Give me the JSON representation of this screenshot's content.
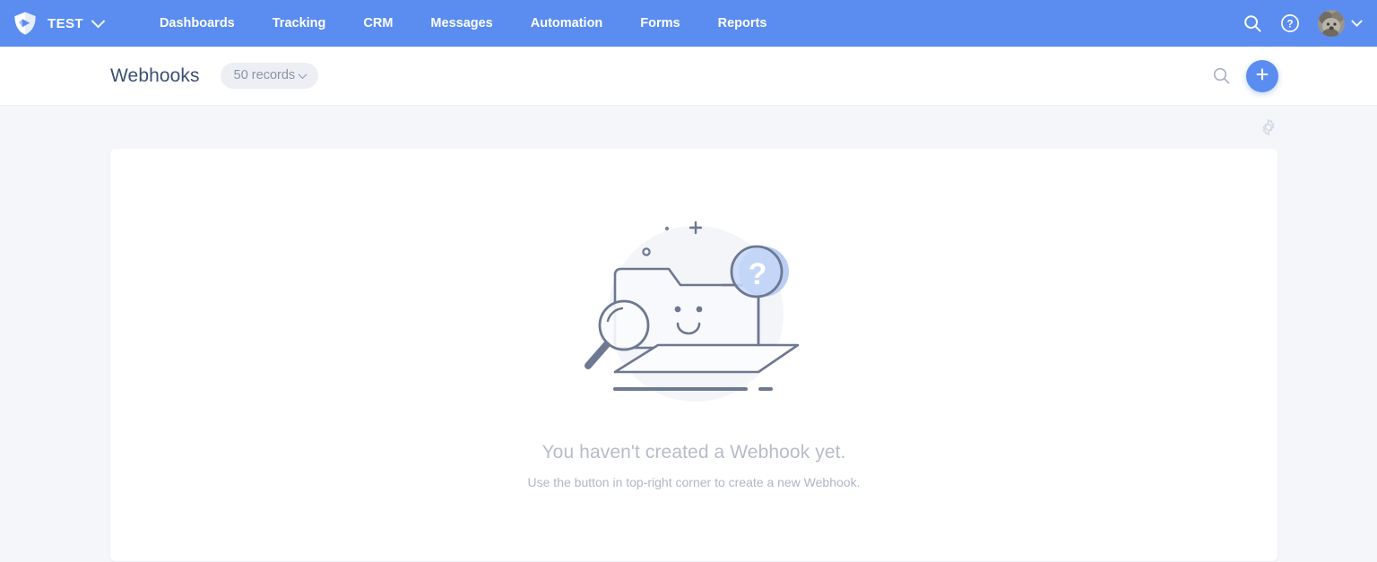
{
  "topnav": {
    "logo_icon": "shield-play-logo-icon",
    "workspace": "TEST",
    "workspace_chevron_icon": "chevron-down-icon",
    "links": [
      {
        "label": "Dashboards",
        "name": "nav-dashboards"
      },
      {
        "label": "Tracking",
        "name": "nav-tracking"
      },
      {
        "label": "CRM",
        "name": "nav-crm"
      },
      {
        "label": "Messages",
        "name": "nav-messages"
      },
      {
        "label": "Automation",
        "name": "nav-automation"
      },
      {
        "label": "Forms",
        "name": "nav-forms"
      },
      {
        "label": "Reports",
        "name": "nav-reports"
      }
    ],
    "search_icon": "search-icon",
    "help_icon": "help-circle-icon",
    "avatar_icon": "user-avatar",
    "account_chevron_icon": "chevron-down-icon",
    "bar_color": "#5b8cf0"
  },
  "pagehead": {
    "title": "Webhooks",
    "records_label": "50 records",
    "records_chevron_icon": "chevron-down-icon",
    "search_icon": "search-icon",
    "add_icon": "plus-icon",
    "add_color": "#5b8cf0"
  },
  "content": {
    "settings_icon": "gear-icon",
    "illustration_name": "empty-folder-search-illustration",
    "empty_title": "You haven't created a Webhook yet.",
    "empty_subtitle": "Use the button in top-right corner to create a new Webhook.",
    "background_color": "#f4f6fa",
    "card_color": "#ffffff",
    "illustration_stroke": "#6d7891",
    "illustration_accent": "#b9cdf5"
  }
}
